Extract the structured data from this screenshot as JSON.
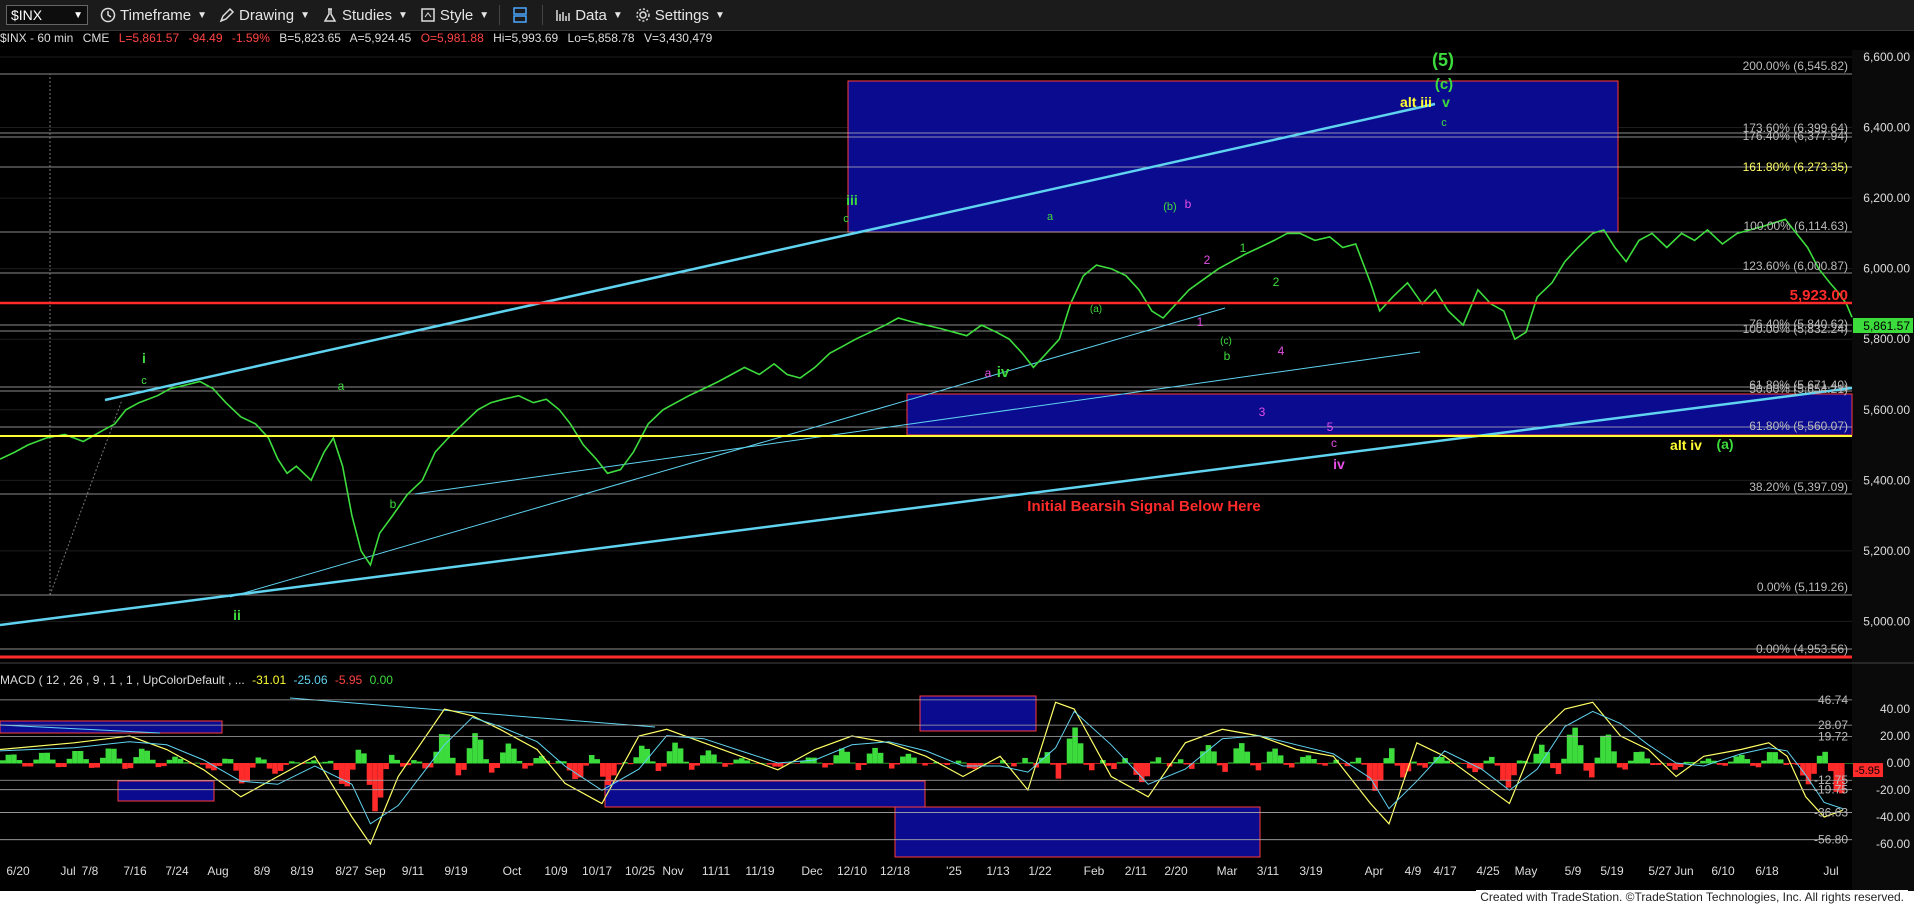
{
  "toolbar": {
    "symbol": "$INX",
    "timeframe": "Timeframe",
    "drawing": "Drawing",
    "studies": "Studies",
    "style": "Style",
    "data": "Data",
    "settings": "Settings"
  },
  "header": {
    "symbol": "$INX - 60 min",
    "exchange": "CME",
    "last": "L=5,861.57",
    "change": "-94.49",
    "pct": "-1.59%",
    "bid": "B=5,823.65",
    "ask": "A=5,924.45",
    "open": "O=5,981.88",
    "high": "Hi=5,993.69",
    "low": "Lo=5,858.78",
    "volume": "V=3,430,479"
  },
  "macd_header": {
    "label": "MACD ( 12 , 26 , 9 , 1 , 1 , UpColorDefault , ...",
    "v1": "-31.01",
    "v2": "-25.06",
    "v3": "-5.95",
    "v4": "0.00"
  },
  "credit": "Created with TradeStation. ©TradeStation Technologies, Inc. All rights reserved.",
  "colors": {
    "bg": "#000000",
    "grid": "#1e1e1e",
    "price": "#3ddc3d",
    "cyan": "#5fd3f0",
    "red": "#ff2a2a",
    "box": "#0b0b8f",
    "yellow": "#ffff33",
    "magenta": "#e64de6",
    "fib": "#bbbbbb"
  },
  "chart_data": {
    "type": "line",
    "title": "$INX - 60 min",
    "ylim": [
      4880,
      6650
    ],
    "y_ticks": [
      5000,
      5200,
      5400,
      5600,
      5800,
      6000,
      6200,
      6400,
      6600
    ],
    "y_tick_labels": [
      "5,000.00",
      "5,200.00",
      "5,400.00",
      "5,600.00",
      "5,800.00",
      "6,000.00",
      "6,200.00",
      "6,400.00",
      "6,600.00"
    ],
    "x_tick_labels": [
      "6/20",
      "Jul",
      "7/8",
      "7/16",
      "7/24",
      "Aug",
      "8/9",
      "8/19",
      "8/27",
      "Sep",
      "9/11",
      "9/19",
      "Oct",
      "10/9",
      "10/17",
      "10/25",
      "Nov",
      "11/11",
      "11/19",
      "Dec",
      "12/10",
      "12/18",
      "'25",
      "1/13",
      "1/22",
      "Feb",
      "2/11",
      "2/20",
      "Mar",
      "3/11",
      "3/19",
      "Apr",
      "4/9",
      "4/17",
      "4/25",
      "May",
      "5/9",
      "5/19",
      "5/27",
      "Jun",
      "6/10",
      "6/18",
      "Jul"
    ],
    "series": [
      {
        "values": [
          [
            0,
            5460
          ],
          [
            8,
            5480
          ],
          [
            15,
            5500
          ],
          [
            25,
            5520
          ],
          [
            35,
            5530
          ],
          [
            45,
            5510
          ],
          [
            55,
            5540
          ],
          [
            62,
            5560
          ],
          [
            68,
            5600
          ],
          [
            75,
            5620
          ],
          [
            85,
            5640
          ],
          [
            92,
            5660
          ],
          [
            100,
            5670
          ],
          [
            108,
            5680
          ],
          [
            115,
            5660
          ],
          [
            122,
            5620
          ],
          [
            130,
            5580
          ],
          [
            138,
            5560
          ],
          [
            145,
            5520
          ],
          [
            150,
            5460
          ],
          [
            155,
            5420
          ],
          [
            160,
            5440
          ],
          [
            168,
            5400
          ],
          [
            175,
            5480
          ],
          [
            180,
            5520
          ],
          [
            185,
            5440
          ],
          [
            190,
            5300
          ],
          [
            195,
            5200
          ],
          [
            200,
            5160
          ],
          [
            205,
            5250
          ],
          [
            212,
            5300
          ],
          [
            220,
            5360
          ],
          [
            228,
            5400
          ],
          [
            235,
            5480
          ],
          [
            242,
            5520
          ],
          [
            250,
            5560
          ],
          [
            258,
            5600
          ],
          [
            265,
            5620
          ],
          [
            272,
            5630
          ],
          [
            280,
            5640
          ],
          [
            288,
            5620
          ],
          [
            295,
            5630
          ],
          [
            302,
            5600
          ],
          [
            308,
            5560
          ],
          [
            315,
            5500
          ],
          [
            322,
            5460
          ],
          [
            328,
            5420
          ],
          [
            335,
            5430
          ],
          [
            342,
            5480
          ],
          [
            350,
            5560
          ],
          [
            358,
            5600
          ],
          [
            365,
            5620
          ],
          [
            372,
            5640
          ],
          [
            380,
            5660
          ],
          [
            388,
            5680
          ],
          [
            395,
            5700
          ],
          [
            402,
            5720
          ],
          [
            410,
            5700
          ],
          [
            418,
            5730
          ],
          [
            425,
            5700
          ],
          [
            432,
            5690
          ],
          [
            440,
            5720
          ],
          [
            448,
            5760
          ],
          [
            455,
            5780
          ],
          [
            462,
            5800
          ],
          [
            470,
            5820
          ],
          [
            478,
            5840
          ],
          [
            485,
            5860
          ],
          [
            492,
            5850
          ],
          [
            500,
            5840
          ],
          [
            508,
            5830
          ],
          [
            515,
            5820
          ],
          [
            522,
            5810
          ],
          [
            530,
            5840
          ],
          [
            538,
            5820
          ],
          [
            545,
            5800
          ],
          [
            552,
            5760
          ],
          [
            558,
            5720
          ],
          [
            565,
            5760
          ],
          [
            572,
            5800
          ],
          [
            578,
            5900
          ],
          [
            585,
            5980
          ],
          [
            592,
            6010
          ],
          [
            600,
            6000
          ],
          [
            608,
            5980
          ],
          [
            615,
            5940
          ],
          [
            622,
            5880
          ],
          [
            628,
            5860
          ],
          [
            635,
            5900
          ],
          [
            642,
            5940
          ],
          [
            650,
            5970
          ],
          [
            658,
            6000
          ],
          [
            665,
            6020
          ],
          [
            672,
            6040
          ],
          [
            680,
            6060
          ],
          [
            688,
            6080
          ],
          [
            695,
            6100
          ],
          [
            702,
            6100
          ],
          [
            710,
            6080
          ],
          [
            718,
            6090
          ],
          [
            725,
            6060
          ],
          [
            732,
            6070
          ],
          [
            740,
            5960
          ],
          [
            745,
            5880
          ],
          [
            752,
            5920
          ],
          [
            760,
            5960
          ],
          [
            768,
            5900
          ],
          [
            775,
            5940
          ],
          [
            782,
            5880
          ],
          [
            790,
            5840
          ],
          [
            798,
            5940
          ],
          [
            805,
            5900
          ],
          [
            812,
            5880
          ],
          [
            818,
            5800
          ],
          [
            824,
            5820
          ],
          [
            830,
            5920
          ],
          [
            838,
            5960
          ],
          [
            845,
            6020
          ],
          [
            852,
            6060
          ],
          [
            860,
            6100
          ],
          [
            866,
            6110
          ],
          [
            872,
            6060
          ],
          [
            878,
            6020
          ],
          [
            885,
            6080
          ],
          [
            892,
            6100
          ],
          [
            900,
            6060
          ],
          [
            908,
            6100
          ],
          [
            915,
            6080
          ],
          [
            922,
            6110
          ],
          [
            930,
            6070
          ],
          [
            938,
            6100
          ],
          [
            945,
            6110
          ],
          [
            952,
            6120
          ],
          [
            958,
            6130
          ],
          [
            964,
            6140
          ],
          [
            970,
            6100
          ],
          [
            976,
            6060
          ],
          [
            982,
            6000
          ],
          [
            988,
            5960
          ],
          [
            993,
            5930
          ],
          [
            997,
            5900
          ],
          [
            1000,
            5862
          ]
        ]
      },
      {
        "name": "MACD",
        "values": [
          [
            0,
            10
          ],
          [
            40,
            15
          ],
          [
            70,
            20
          ],
          [
            90,
            10
          ],
          [
            110,
            -5
          ],
          [
            130,
            -25
          ],
          [
            150,
            -10
          ],
          [
            170,
            5
          ],
          [
            190,
            -40
          ],
          [
            200,
            -60
          ],
          [
            215,
            -10
          ],
          [
            240,
            40
          ],
          [
            255,
            35
          ],
          [
            270,
            25
          ],
          [
            290,
            10
          ],
          [
            305,
            -15
          ],
          [
            325,
            -30
          ],
          [
            345,
            20
          ],
          [
            360,
            25
          ],
          [
            380,
            15
          ],
          [
            400,
            5
          ],
          [
            420,
            -5
          ],
          [
            440,
            10
          ],
          [
            460,
            20
          ],
          [
            480,
            15
          ],
          [
            500,
            5
          ],
          [
            520,
            -10
          ],
          [
            540,
            5
          ],
          [
            555,
            -20
          ],
          [
            570,
            45
          ],
          [
            580,
            40
          ],
          [
            600,
            -10
          ],
          [
            620,
            -25
          ],
          [
            640,
            15
          ],
          [
            660,
            25
          ],
          [
            680,
            20
          ],
          [
            700,
            10
          ],
          [
            720,
            5
          ],
          [
            740,
            -30
          ],
          [
            750,
            -45
          ],
          [
            765,
            15
          ],
          [
            780,
            5
          ],
          [
            800,
            -15
          ],
          [
            815,
            -30
          ],
          [
            830,
            20
          ],
          [
            845,
            40
          ],
          [
            860,
            45
          ],
          [
            875,
            20
          ],
          [
            890,
            10
          ],
          [
            905,
            -10
          ],
          [
            920,
            5
          ],
          [
            940,
            10
          ],
          [
            955,
            15
          ],
          [
            965,
            5
          ],
          [
            975,
            -25
          ],
          [
            985,
            -40
          ],
          [
            995,
            -35
          ]
        ]
      }
    ],
    "fib_labels": [
      "200.00% (6,545.82)",
      "173.60% (6,399.64)",
      "176.40% (6,377.94)",
      "161.80% (6,273.35)",
      "100.00% (6,114.63)",
      "123.60% (6,000.87)",
      "76.40% (5,840.62)",
      "100.00% (5,832.24)",
      "61.80% (5,671.40)",
      "50.00% (5,654.21)",
      "61.80% (5,560.07)",
      "38.20% (5,397.09)",
      "0.00% (5,119.26)",
      "0.00% (4,953.56)"
    ],
    "level_label": "5,923.00",
    "price_label": "5,861.57",
    "annotations": [
      "(5)",
      "(c)",
      "alt iii",
      "v",
      "c",
      "iii",
      "c",
      "a",
      "(b)",
      "b",
      "1",
      "2",
      "1",
      "2",
      "(a)",
      "(c)",
      "b",
      "4",
      "3",
      "5",
      "c",
      "iv",
      "alt iv",
      "(a)",
      "i",
      "c",
      "a",
      "b",
      "a",
      "iv",
      "ii",
      "Initial Bearsih Signal Below Here"
    ],
    "macd_ticks": [
      "40.00",
      "20.00",
      "0.00",
      "-20.00",
      "-40.00",
      "-60.00"
    ],
    "macd_levels": [
      "46.74",
      "28.07",
      "19.72",
      "-12.75",
      "-19.75",
      "-36.63",
      "-56.80"
    ],
    "macd_value_tag": "-5.95"
  }
}
